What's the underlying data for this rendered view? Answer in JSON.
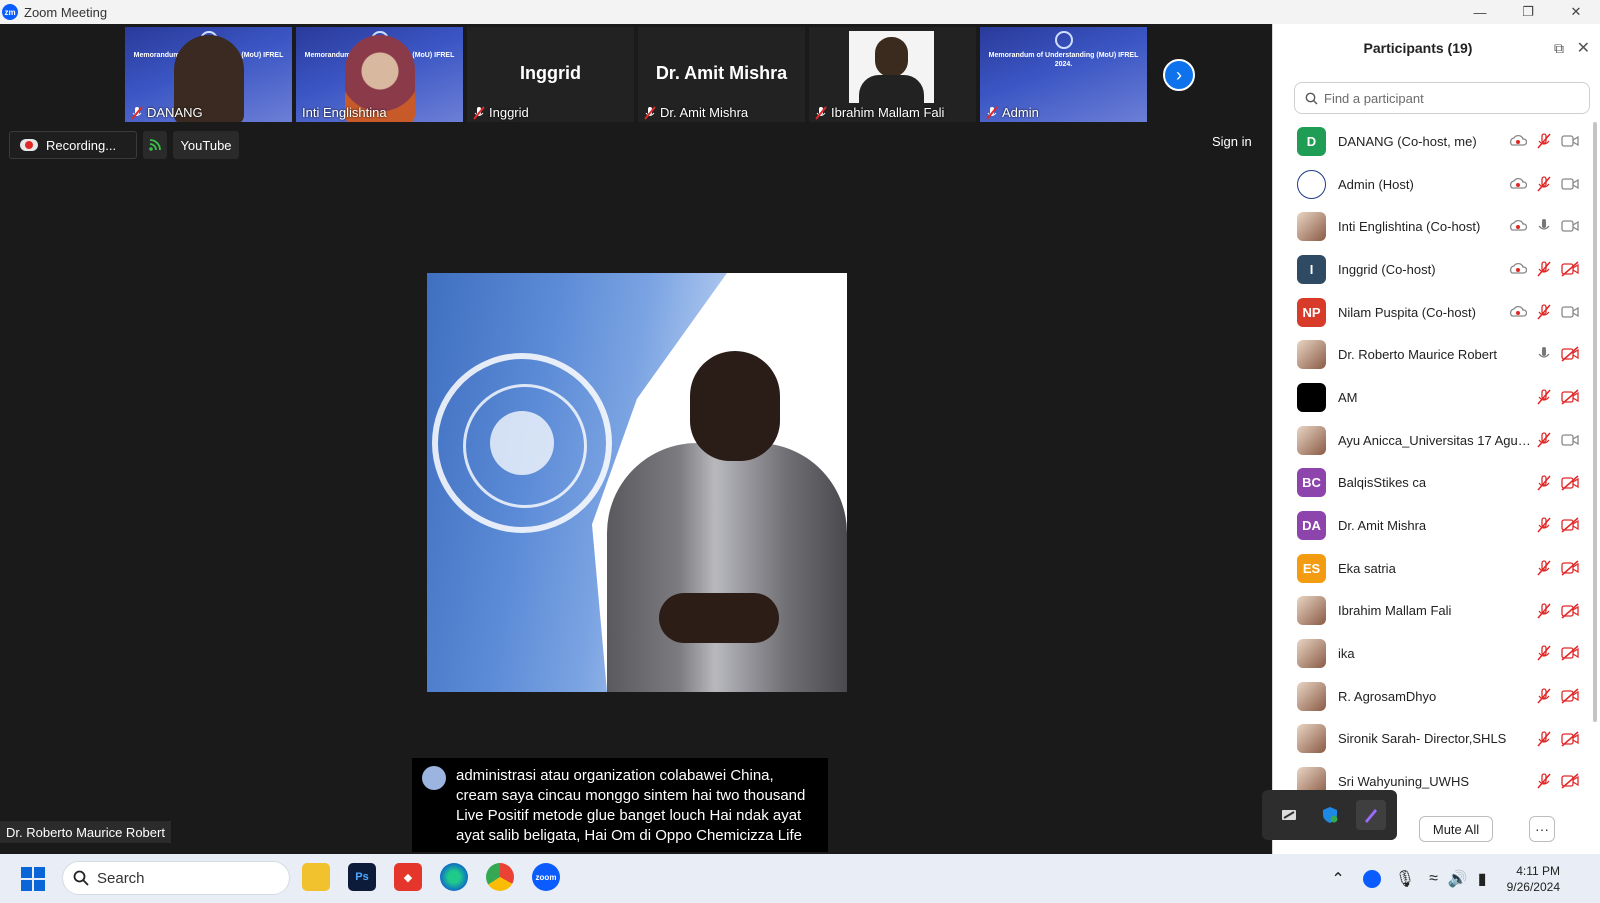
{
  "window": {
    "title": "Zoom Meeting",
    "app_icon": "zm"
  },
  "thumbnails": [
    {
      "name": "DANANG",
      "type": "video-banner",
      "banner_text": "Memorandum of Understanding (MoU) IFREL 2024."
    },
    {
      "name": "Inti Englishtina",
      "type": "video-woman",
      "banner_text": "Memorandum of Understanding (MoU) IFREL 2024."
    },
    {
      "name": "Inggrid",
      "type": "name-only",
      "big_name": "Inggrid"
    },
    {
      "name": "Dr. Amit Mishra",
      "type": "name-only",
      "big_name": "Dr. Amit Mishra"
    },
    {
      "name": "Ibrahim Mallam Fali",
      "type": "photo"
    },
    {
      "name": "Admin",
      "type": "banner",
      "banner_text": "Memorandum of Understanding (MoU) IFREL 2024."
    }
  ],
  "toolbar": {
    "recording_label": "Recording...",
    "stream_label": "YouTube",
    "sign_in": "Sign in"
  },
  "caption": {
    "text": "administrasi atau organization colabawei China, cream saya cincau monggo sintem hai two thousand Live Positif metode glue banget louch Hai ndak ayat ayat salib beligata, Hai Om di Oppo Chemicizza Life"
  },
  "active_speaker": "Dr. Roberto Maurice Robert",
  "participants_panel": {
    "title": "Participants (19)",
    "search_placeholder": "Find a participant",
    "mute_all": "Mute All",
    "more": "···",
    "participants": [
      {
        "name": "DANANG (Co-host, me)",
        "initials": "D",
        "color": "#1f9d55",
        "avatar": "initials",
        "rec": true,
        "mic": "muted",
        "video": "on"
      },
      {
        "name": "Admin (Host)",
        "initials": "",
        "color": "#ffffff",
        "avatar": "logo",
        "rec": true,
        "mic": "muted",
        "video": "on"
      },
      {
        "name": "Inti Englishtina (Co-host)",
        "initials": "",
        "color": "#ffffff",
        "avatar": "photo",
        "rec": true,
        "mic": "on",
        "video": "on"
      },
      {
        "name": "Inggrid (Co-host)",
        "initials": "I",
        "color": "#2f4a63",
        "avatar": "initials",
        "rec": true,
        "mic": "muted",
        "video": "off"
      },
      {
        "name": "Nilam Puspita (Co-host)",
        "initials": "NP",
        "color": "#d93b2b",
        "avatar": "initials",
        "rec": true,
        "mic": "muted",
        "video": "on"
      },
      {
        "name": "Dr. Roberto Maurice Robert",
        "initials": "",
        "color": "#5b8ad6",
        "avatar": "photo",
        "rec": false,
        "mic": "on",
        "video": "off"
      },
      {
        "name": "AM",
        "initials": "",
        "color": "#000000",
        "avatar": "initials",
        "rec": false,
        "mic": "muted",
        "video": "off"
      },
      {
        "name": "Ayu Anicca_Universitas 17 Agust...",
        "initials": "",
        "color": "#6d7b8c",
        "avatar": "photo",
        "rec": false,
        "mic": "muted",
        "video": "on"
      },
      {
        "name": "BalqisStikes ca",
        "initials": "BC",
        "color": "#8e44ad",
        "avatar": "initials",
        "rec": false,
        "mic": "muted",
        "video": "off"
      },
      {
        "name": "Dr. Amit Mishra",
        "initials": "DA",
        "color": "#8e44ad",
        "avatar": "initials",
        "rec": false,
        "mic": "muted",
        "video": "off"
      },
      {
        "name": "Eka satria",
        "initials": "ES",
        "color": "#f39c12",
        "avatar": "initials",
        "rec": false,
        "mic": "muted",
        "video": "off"
      },
      {
        "name": "Ibrahim Mallam Fali",
        "initials": "",
        "color": "#5a3a2a",
        "avatar": "photo",
        "rec": false,
        "mic": "muted",
        "video": "off"
      },
      {
        "name": "ika",
        "initials": "",
        "color": "#e8b4c4",
        "avatar": "photo",
        "rec": false,
        "mic": "muted",
        "video": "off"
      },
      {
        "name": "R. AgrosamDhyo",
        "initials": "",
        "color": "#8a7a4a",
        "avatar": "photo",
        "rec": false,
        "mic": "muted",
        "video": "off"
      },
      {
        "name": "Sironik Sarah- Director,SHLS",
        "initials": "",
        "color": "#3a2a3a",
        "avatar": "photo",
        "rec": false,
        "mic": "muted",
        "video": "off"
      },
      {
        "name": "Sri Wahyuning_UWHS",
        "initials": "",
        "color": "#d8c4e4",
        "avatar": "photo",
        "rec": false,
        "mic": "muted",
        "video": "off"
      }
    ]
  },
  "taskbar": {
    "search_label": "Search",
    "apps": [
      {
        "name": "file-explorer",
        "label": ""
      },
      {
        "name": "photoshop",
        "label": "Ps"
      },
      {
        "name": "anydesk",
        "label": ""
      },
      {
        "name": "edge",
        "label": ""
      },
      {
        "name": "chrome",
        "label": ""
      },
      {
        "name": "zoom",
        "label": "zoom"
      }
    ],
    "time": "4:11 PM",
    "date": "9/26/2024"
  },
  "colors": {
    "zoom_blue": "#0e72ed",
    "muted_red": "#e02828",
    "dark_bg": "#1a1a1a"
  }
}
